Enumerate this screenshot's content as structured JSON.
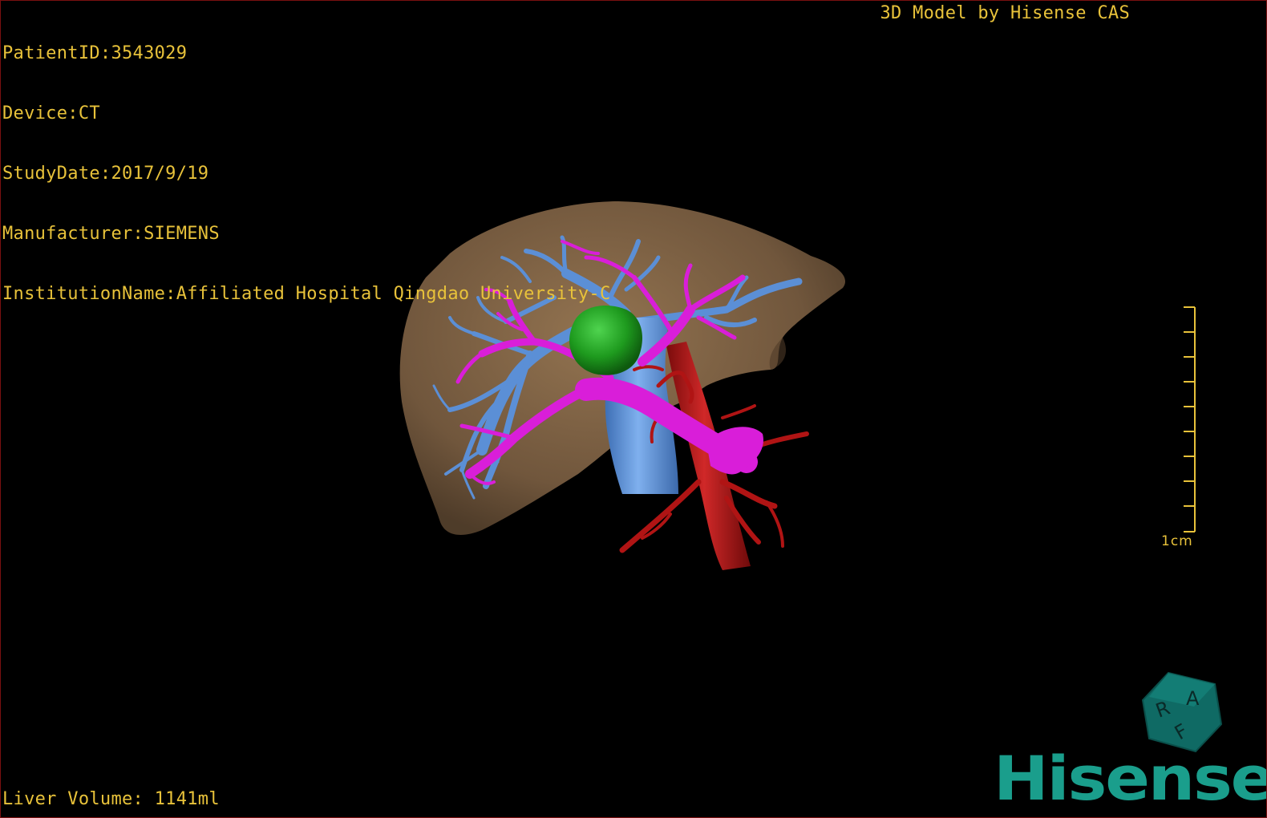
{
  "overlay": {
    "patient_id": "PatientID:3543029",
    "device": "Device:CT",
    "study_date": "StudyDate:2017/9/19",
    "manufacturer": "Manufacturer:SIEMENS",
    "institution": "InstitutionName:Affiliated Hospital Qingdao University-C",
    "model_credit": "3D Model by Hisense CAS",
    "liver_volume": "Liver Volume: 1141ml"
  },
  "scale": {
    "label": "1cm"
  },
  "orientation_cube": {
    "labels": [
      "R",
      "A",
      "F"
    ]
  },
  "logo": {
    "text": "Hisense"
  },
  "colors": {
    "overlay_text": "#e8c23a",
    "liver": "#8a6a48",
    "hepatic_vein": "#5b8fd6",
    "portal_vein": "#d91ed9",
    "artery": "#b01414",
    "tumor": "#1fa31f",
    "brand": "#1a9e8c"
  }
}
